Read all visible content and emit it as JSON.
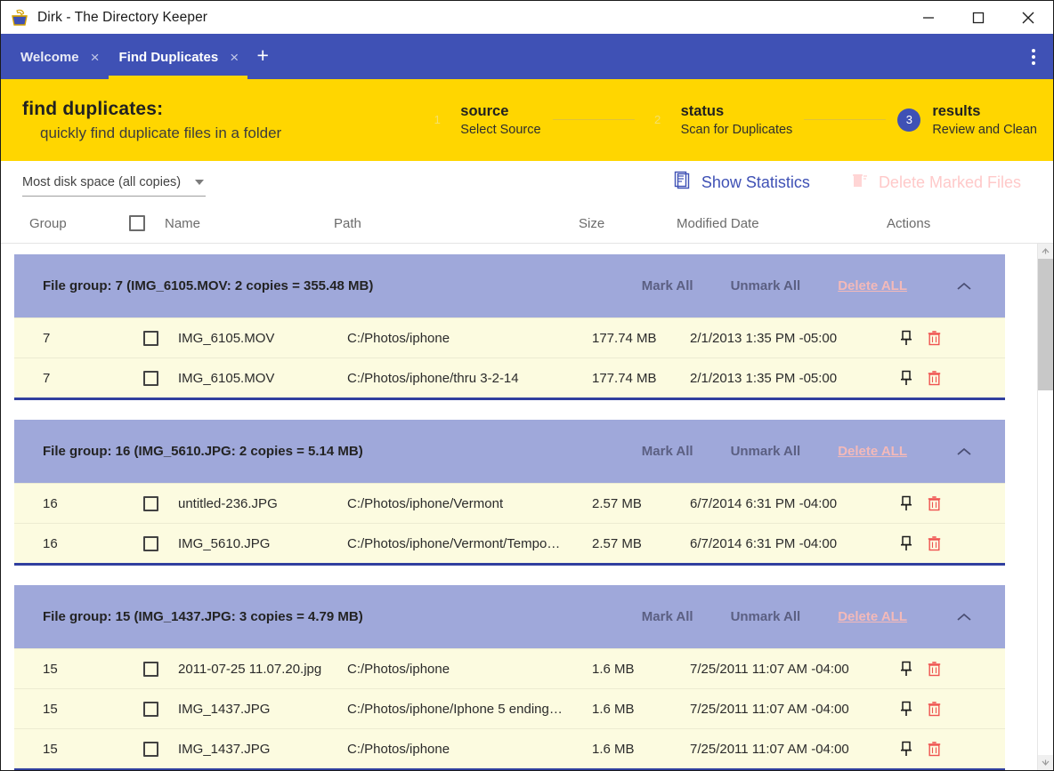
{
  "window": {
    "title": "Dirk - The Directory Keeper",
    "app_icon": "basket-icon",
    "minimize_label": "Minimize",
    "maximize_label": "Maximize",
    "close_label": "Close"
  },
  "tabs": {
    "items": [
      {
        "label": "Welcome",
        "close": "×",
        "active": false
      },
      {
        "label": "Find Duplicates",
        "close": "×",
        "active": true
      }
    ],
    "add_label": "+",
    "menu_icon": "kebab-menu-icon"
  },
  "banner": {
    "title": "find duplicates:",
    "subtitle": "quickly find duplicate files in a folder",
    "steps": [
      {
        "num": "1",
        "title": "source",
        "sub": "Select Source",
        "active": false
      },
      {
        "num": "2",
        "title": "status",
        "sub": "Scan for Duplicates",
        "active": false
      },
      {
        "num": "3",
        "title": "results",
        "sub": "Review and Clean",
        "active": true
      }
    ]
  },
  "toolbar": {
    "sort_value": "Most disk space (all copies)",
    "sort_caret_icon": "chevron-down-icon",
    "show_statistics": {
      "label": "Show Statistics",
      "icon": "clipboard-icon",
      "enabled": true
    },
    "delete_marked": {
      "label": "Delete Marked Files",
      "icon": "trash-icon",
      "enabled": false
    }
  },
  "table": {
    "columns": [
      "Group",
      "",
      "Name",
      "Path",
      "Size",
      "Modified Date",
      "Actions"
    ],
    "header_checkbox_checked": false,
    "group_actions": {
      "mark_all": "Mark All",
      "unmark_all": "Unmark All",
      "delete_all": "Delete ALL",
      "collapse_icon": "chevron-up-icon"
    },
    "row_actions": {
      "pin_icon": "pin-icon",
      "delete_icon": "trash-icon"
    },
    "groups": [
      {
        "header": "File group: 7 (IMG_6105.MOV: 2 copies = 355.48 MB)",
        "rows": [
          {
            "group": "7",
            "checked": false,
            "name": "IMG_6105.MOV",
            "path": "C:/Photos/iphone",
            "size": "177.74 MB",
            "modified": "2/1/2013 1:35 PM -05:00"
          },
          {
            "group": "7",
            "checked": false,
            "name": "IMG_6105.MOV",
            "path": "C:/Photos/iphone/thru 3-2-14",
            "size": "177.74 MB",
            "modified": "2/1/2013 1:35 PM -05:00"
          }
        ]
      },
      {
        "header": "File group: 16 (IMG_5610.JPG: 2 copies = 5.14 MB)",
        "rows": [
          {
            "group": "16",
            "checked": false,
            "name": "untitled-236.JPG",
            "path": "C:/Photos/iphone/Vermont",
            "size": "2.57 MB",
            "modified": "6/7/2014 6:31 PM -04:00"
          },
          {
            "group": "16",
            "checked": false,
            "name": "IMG_5610.JPG",
            "path": "C:/Photos/iphone/Vermont/Tempo…",
            "size": "2.57 MB",
            "modified": "6/7/2014 6:31 PM -04:00"
          }
        ]
      },
      {
        "header": "File group: 15 (IMG_1437.JPG: 3 copies = 4.79 MB)",
        "rows": [
          {
            "group": "15",
            "checked": false,
            "name": "2011-07-25 11.07.20.jpg",
            "path": "C:/Photos/iphone",
            "size": "1.6 MB",
            "modified": "7/25/2011 11:07 AM -04:00"
          },
          {
            "group": "15",
            "checked": false,
            "name": "IMG_1437.JPG",
            "path": "C:/Photos/iphone/Iphone 5 ending…",
            "size": "1.6 MB",
            "modified": "7/25/2011 11:07 AM -04:00"
          },
          {
            "group": "15",
            "checked": false,
            "name": "IMG_1437.JPG",
            "path": "C:/Photos/iphone",
            "size": "1.6 MB",
            "modified": "7/25/2011 11:07 AM -04:00"
          }
        ]
      }
    ]
  },
  "scrollbar": {
    "up_icon": "arrow-up-icon",
    "down_icon": "arrow-down-icon"
  },
  "colors": {
    "accent_blue": "#3f51b5",
    "banner_yellow": "#ffd600",
    "group_header": "#9fa8da",
    "row_cream": "#fcfbe0",
    "danger_red": "#ef5350",
    "disabled_pink": "#ffc9c9"
  }
}
